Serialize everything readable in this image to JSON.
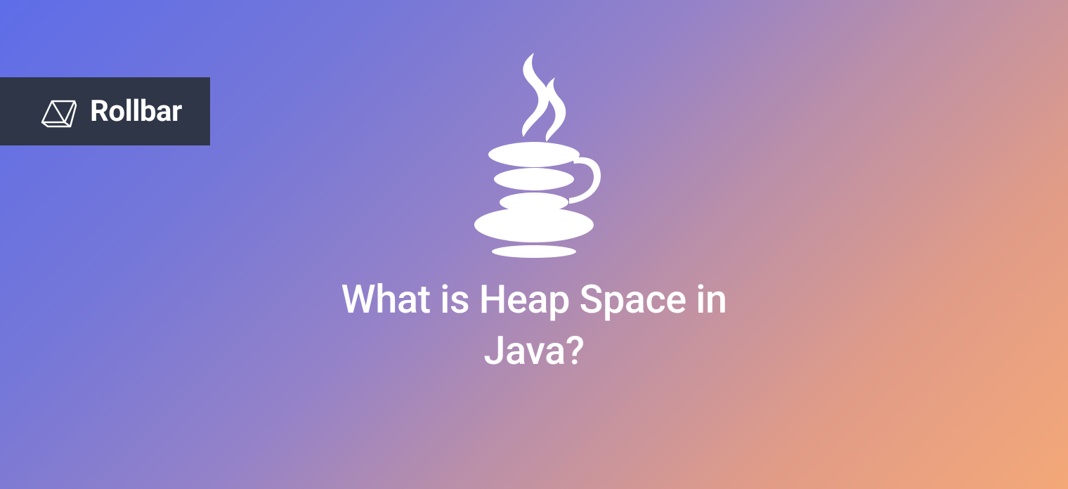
{
  "brand": {
    "name": "Rollbar",
    "icon_name": "rollbar-logo-icon"
  },
  "main": {
    "icon_name": "java-icon",
    "title": "What is Heap Space in Java?"
  },
  "colors": {
    "badge_bg": "#2e3647",
    "text": "#ffffff"
  }
}
